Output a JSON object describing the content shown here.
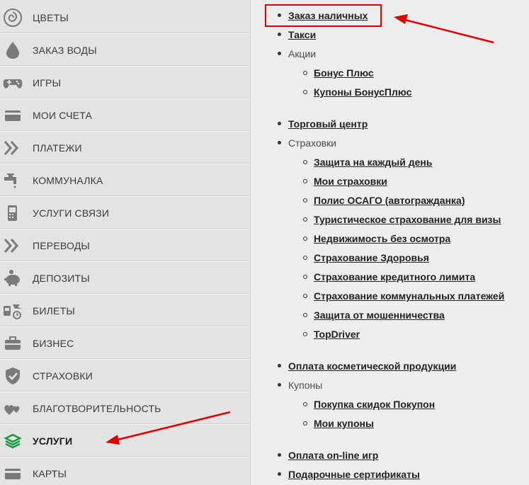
{
  "sidebar": {
    "items": [
      {
        "label": "Цветы",
        "icon": "rose-icon"
      },
      {
        "label": "Заказ воды",
        "icon": "water-drop-icon"
      },
      {
        "label": "Игры",
        "icon": "gamepad-icon"
      },
      {
        "label": "Мои счета",
        "icon": "card-icon"
      },
      {
        "label": "Платежи",
        "icon": "double-chevron-icon"
      },
      {
        "label": "Коммуналка",
        "icon": "faucet-icon"
      },
      {
        "label": "Услуги связи",
        "icon": "phone-icon"
      },
      {
        "label": "Переводы",
        "icon": "double-chevron-icon"
      },
      {
        "label": "Депозиты",
        "icon": "piggy-bank-icon"
      },
      {
        "label": "Билеты",
        "icon": "tickets-icon"
      },
      {
        "label": "Бизнес",
        "icon": "briefcase-icon"
      },
      {
        "label": "Страховки",
        "icon": "shield-icon"
      },
      {
        "label": "Благотворительность",
        "icon": "hearts-icon"
      },
      {
        "label": "Услуги",
        "icon": "layers-icon",
        "active": true
      },
      {
        "label": "Карты",
        "icon": "card-icon"
      }
    ]
  },
  "content": {
    "cash_order": "Заказ наличных",
    "taxi": "Такси",
    "promotions": "Акции",
    "bonus_plus": "Бонус Плюс",
    "bonus_coupons": "Купоны БонусПлюс",
    "mall": "Торговый центр",
    "insurance": "Страховки",
    "protection_daily": "Защита на каждый день",
    "my_insurance": "Мои страховки",
    "osago": "Полис ОСАГО (автогражданка)",
    "travel_insurance": "Туристическое страхование для визы",
    "realty": "Недвижимость без осмотра",
    "health": "Страхование Здоровья",
    "credit_limit": "Страхование кредитного лимита",
    "utility_payments": "Страхование коммунальных платежей",
    "fraud": "Защита от мошенничества",
    "topdriver": "TopDriver",
    "cosmetics": "Оплата косметической продукции",
    "coupons": "Купоны",
    "pokupon": "Покупка скидок Покупон",
    "my_coupons": "Мои купоны",
    "online_games": "Оплата on-line игр",
    "gift_certs": "Подарочные сертификаты"
  },
  "colors": {
    "annotation": "#e00000",
    "active_icon": "#1a9a3a"
  }
}
